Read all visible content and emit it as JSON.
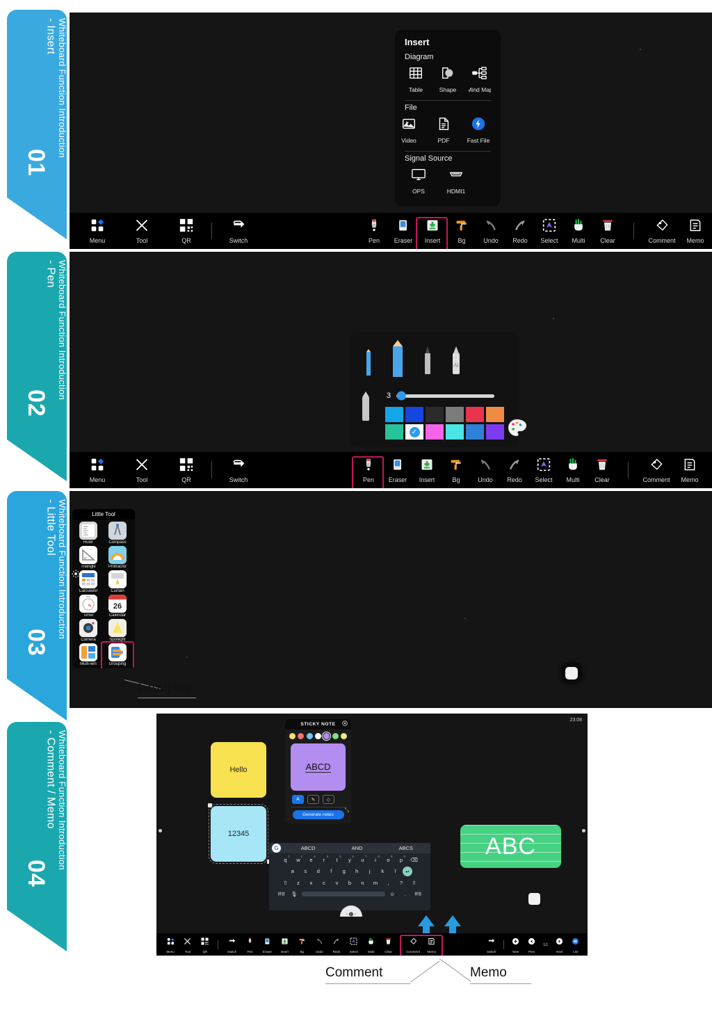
{
  "sections": [
    {
      "id": "01",
      "number": "01",
      "title": "Whiteboard Function Introduction",
      "subtitle": "- Insert",
      "accent": "#3aa9e0",
      "highlighted_tool": "Insert"
    },
    {
      "id": "02",
      "number": "02",
      "title": "Whiteboard Function Introduction",
      "subtitle": "- Pen",
      "accent": "#1aa8ae",
      "highlighted_tool": "Pen"
    },
    {
      "id": "03",
      "number": "03",
      "title": "Whiteboard Function Introduction",
      "subtitle": "- Little Tool",
      "accent": "#2ba6dd",
      "highlighted_tool": "Grouping"
    },
    {
      "id": "04",
      "number": "04",
      "title": "Whiteboard Function Introduction",
      "subtitle": "- Comment / Memo",
      "accent": "#1aa8ae",
      "highlighted_tool": "Comment / Memo"
    }
  ],
  "insert_panel": {
    "title": "Insert",
    "groups": [
      {
        "label": "Diagram",
        "items": [
          {
            "label": "Table",
            "icon": "table-icon"
          },
          {
            "label": "Shape",
            "icon": "shape-icon"
          },
          {
            "label": "Mind Map",
            "icon": "mind-map-icon"
          }
        ]
      },
      {
        "label": "File",
        "items": [
          {
            "label": "Video",
            "icon": "video-icon"
          },
          {
            "label": "PDF",
            "icon": "pdf-icon"
          },
          {
            "label": "Fast File",
            "icon": "fast-file-icon"
          }
        ]
      },
      {
        "label": "Signal Source",
        "items": [
          {
            "label": "OPS",
            "icon": "monitor-icon"
          },
          {
            "label": "HDMI1",
            "icon": "hdmi-icon"
          }
        ]
      }
    ]
  },
  "toolbar_left": [
    {
      "label": "Menu",
      "icon": "menu-grid-icon"
    },
    {
      "label": "Tool",
      "icon": "tools-icon"
    },
    {
      "label": "QR",
      "icon": "qr-code-icon"
    },
    {
      "label": "Switch",
      "icon": "switch-icon"
    }
  ],
  "toolbar_right": [
    {
      "label": "Pen",
      "icon": "pen-icon"
    },
    {
      "label": "Eraser",
      "icon": "eraser-icon"
    },
    {
      "label": "Insert",
      "icon": "insert-icon"
    },
    {
      "label": "Bg",
      "icon": "paint-roller-icon"
    },
    {
      "label": "Undo",
      "icon": "undo-arrow-icon"
    },
    {
      "label": "Redo",
      "icon": "redo-arrow-icon"
    },
    {
      "label": "Select",
      "icon": "select-marquee-icon"
    },
    {
      "label": "Multi",
      "icon": "multi-finger-icon"
    },
    {
      "label": "Clear",
      "icon": "trash-icon"
    },
    {
      "label": "Comment",
      "icon": "tag-comment-icon"
    },
    {
      "label": "Memo",
      "icon": "memo-icon"
    }
  ],
  "pen_panel": {
    "pens": [
      {
        "name": "thin-blue-pencil"
      },
      {
        "name": "thick-blue-pencil"
      },
      {
        "name": "dark-marker"
      },
      {
        "name": "ai-pen"
      },
      {
        "name": "grey-pen"
      }
    ],
    "size_value": "3",
    "slider_position_pct": 4,
    "colors_row1": [
      "#11a7e8",
      "#1745e0",
      "#2b2b2b",
      "#7c7c7c",
      "#e8344c",
      "#ef8b42"
    ],
    "colors_row2": [
      "#27c39a",
      "#ffffff",
      "#f463e8",
      "#4ce5e5",
      "#2f80d8",
      "#7c3cf0"
    ],
    "selected_color_index": 7,
    "palette_icon": "color-palette-icon"
  },
  "little_tool": {
    "title": "Little Tool",
    "items": [
      {
        "label": "Ruler",
        "icon": "ruler-icon"
      },
      {
        "label": "Compass",
        "icon": "compass-icon"
      },
      {
        "label": "Triangle",
        "icon": "triangle-ruler-icon"
      },
      {
        "label": "Protractor",
        "icon": "protractor-icon"
      },
      {
        "label": "Calculator",
        "icon": "calculator-icon"
      },
      {
        "label": "Curtain",
        "icon": "curtain-icon"
      },
      {
        "label": "Timer",
        "icon": "timer-icon"
      },
      {
        "label": "Calendar",
        "icon": "calendar-icon"
      },
      {
        "label": "Camera",
        "icon": "camera-icon"
      },
      {
        "label": "Spotlight",
        "icon": "spotlight-icon"
      },
      {
        "label": "Multi-win",
        "icon": "multi-window-icon"
      },
      {
        "label": "Grouping",
        "icon": "grouping-icon"
      }
    ],
    "calendar_day": "26",
    "callout_label": "Grouping"
  },
  "section4": {
    "clock": "23:08",
    "notes": [
      {
        "text": "Hello",
        "color": "#f7e14f"
      },
      {
        "text": "12345",
        "color": "#a6e6f7"
      }
    ],
    "abc_board": {
      "text": "ABC",
      "color": "#46d183"
    },
    "sticky_panel": {
      "title": "STICKY NOTE",
      "close_icon": "close-circle-icon",
      "colors": [
        "#f4e06a",
        "#f4706a",
        "#6ac9f4",
        "#ffffff",
        "#b48df0",
        "#7ee07e",
        "#ecec86"
      ],
      "selected_color": "#b48df0",
      "note_text": "ABCD",
      "tools": [
        {
          "icon": "text-tool-icon",
          "label": "AT"
        },
        {
          "icon": "pen-tool-icon",
          "label": ""
        },
        {
          "icon": "eraser-tool-icon",
          "label": ""
        }
      ],
      "generate_button": "Generate notes",
      "resize_icon": "resize-handle-icon"
    },
    "keyboard": {
      "suggestions": [
        "ABCD",
        "AND",
        "ABCS"
      ],
      "google_icon": "google-g-icon",
      "row1": [
        "q",
        "w",
        "e",
        "r",
        "t",
        "y",
        "u",
        "i",
        "o",
        "p"
      ],
      "row1_sup": [
        "1",
        "2",
        "3",
        "4",
        "5",
        "6",
        "7",
        "8",
        "9",
        "0"
      ],
      "row2": [
        "a",
        "s",
        "d",
        "f",
        "g",
        "h",
        "j",
        "k",
        "l"
      ],
      "row3": [
        "z",
        "x",
        "c",
        "v",
        "b",
        "n",
        "m"
      ],
      "shift_icon": "shift-icon",
      "backspace_icon": "backspace-icon",
      "enter_icon": "enter-icon",
      "comma": ",",
      "period": "?",
      "lang_label": "拼音",
      "mic_icon": "mic-icon",
      "emoji_icon": "emoji-icon"
    },
    "page_controls": [
      {
        "label": "Switch",
        "icon": "switch-icon"
      },
      {
        "label": "New",
        "icon": "plus-circle-icon"
      },
      {
        "label": "Prev",
        "icon": "prev-circle-icon"
      },
      {
        "label": "Next",
        "icon": "next-circle-icon"
      },
      {
        "label": "List",
        "icon": "list-circle-icon"
      }
    ],
    "page_indicator": "1/1",
    "callouts": [
      {
        "label": "Comment"
      },
      {
        "label": "Memo"
      }
    ]
  },
  "colors": {
    "highlight_border": "#c2185b",
    "screen_bg": "#151515",
    "toolbar_bg": "#000000",
    "accent_blue": "#3aa9e0",
    "accent_teal": "#1aa8ae"
  }
}
